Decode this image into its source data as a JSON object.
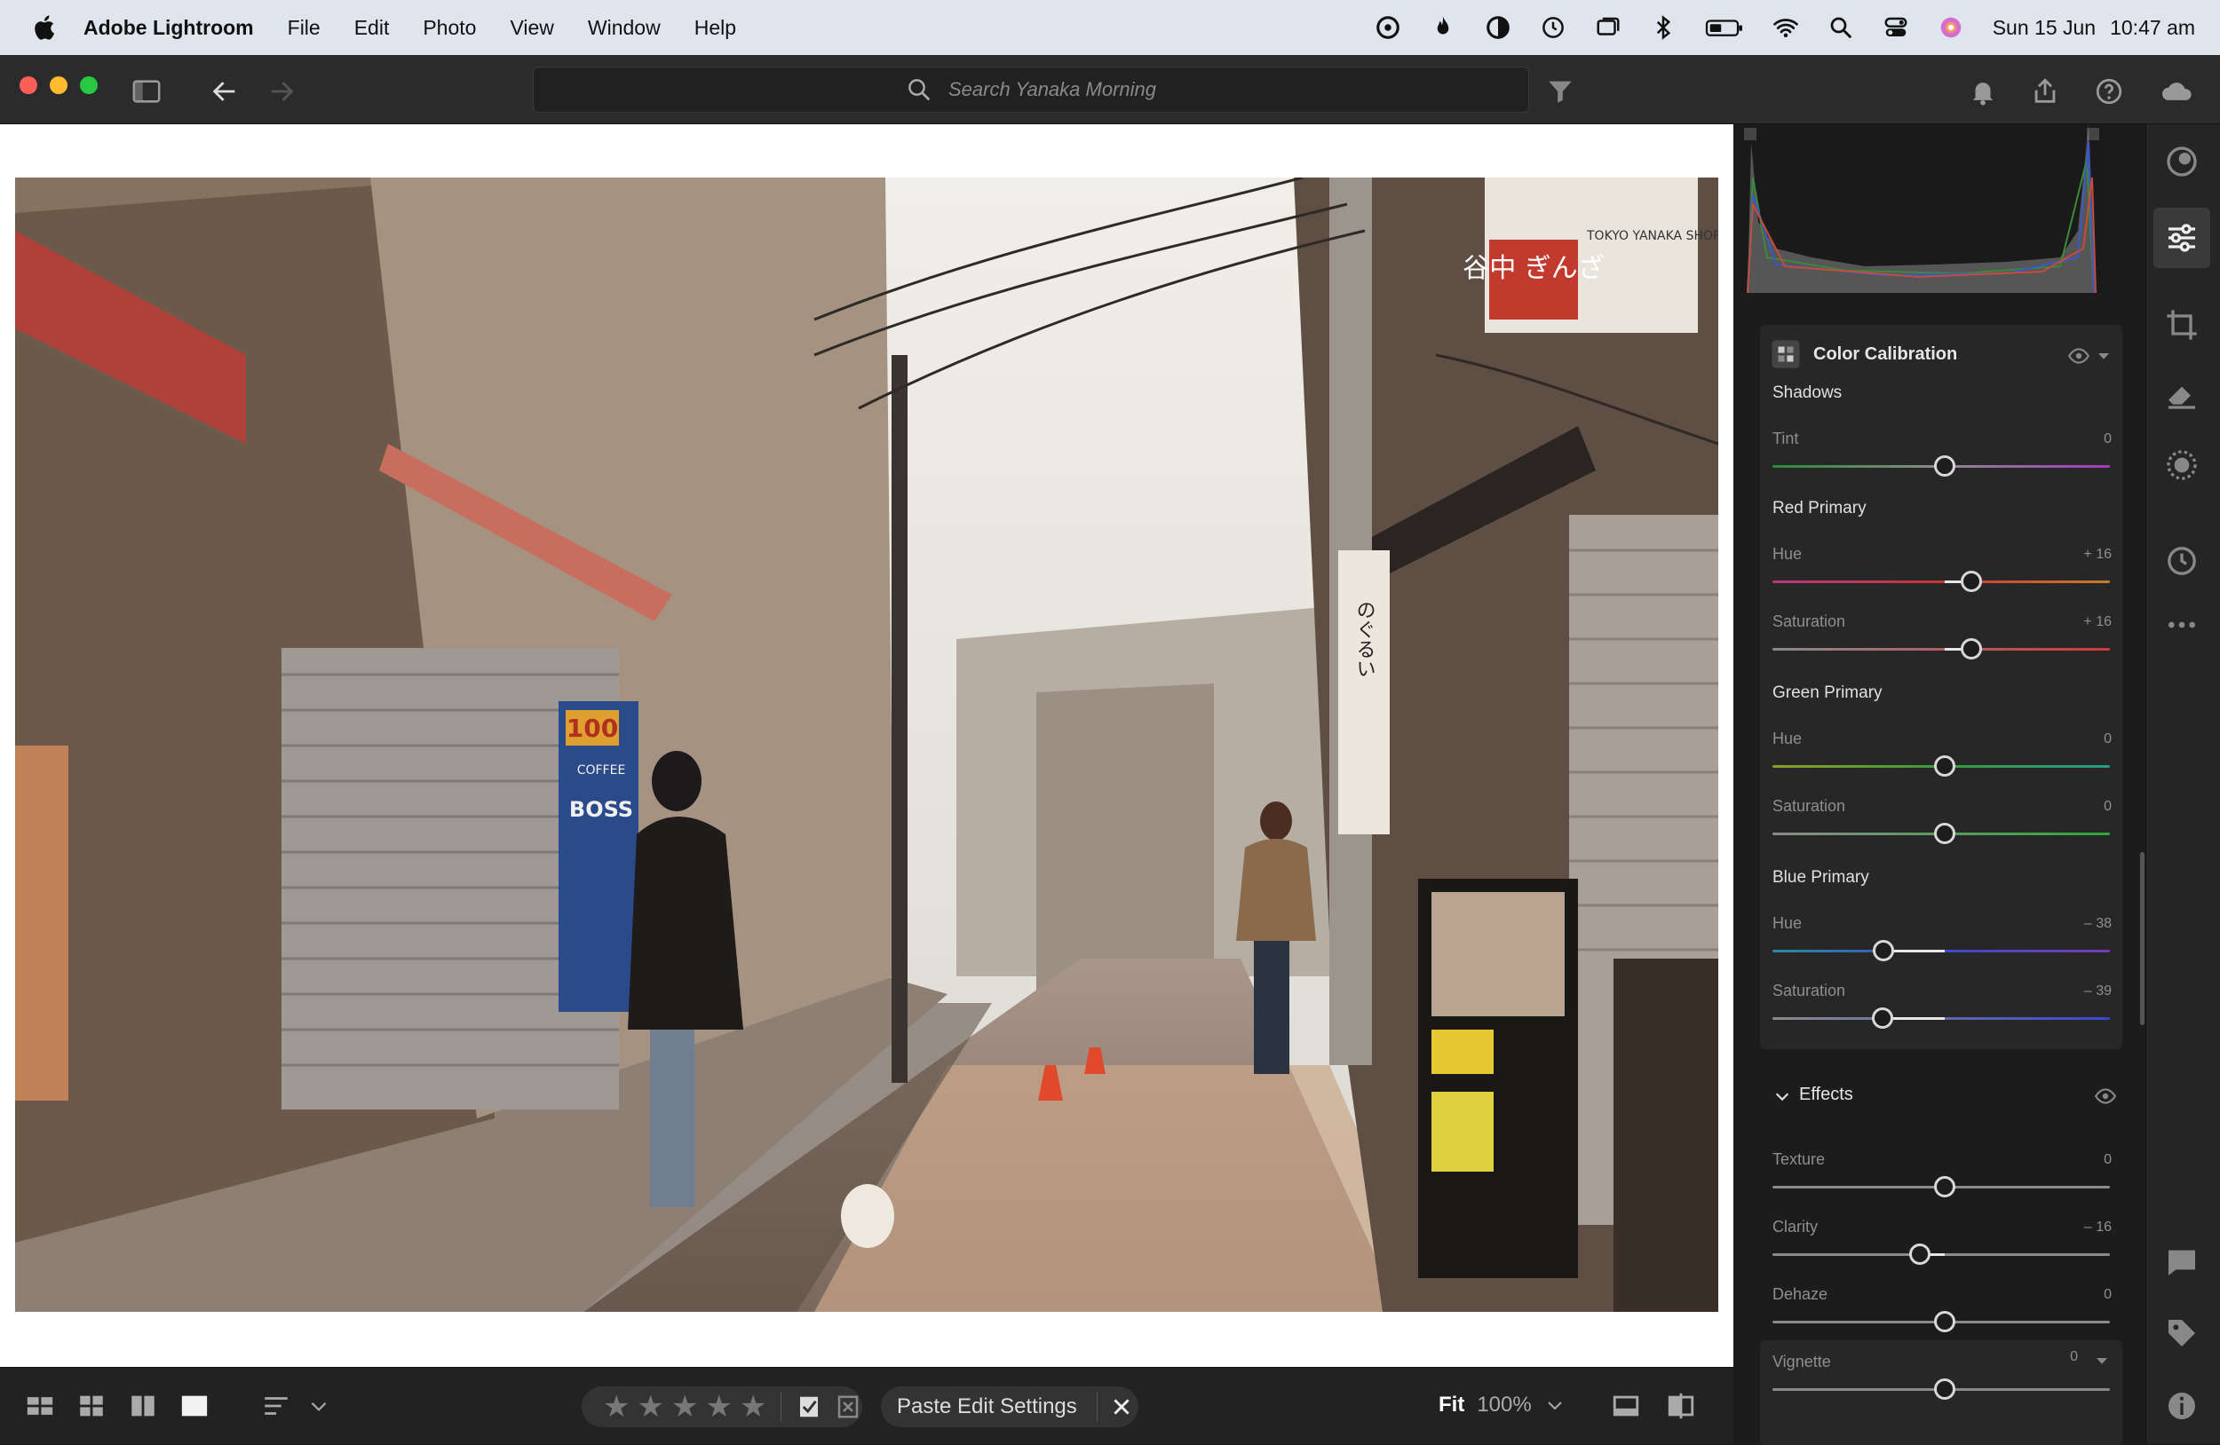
{
  "menubar": {
    "app_name": "Adobe Lightroom",
    "items": [
      "File",
      "Edit",
      "Photo",
      "View",
      "Window",
      "Help"
    ],
    "date": "Sun 15 Jun",
    "time": "10:47 am"
  },
  "titlebar": {
    "search_placeholder": "Search Yanaka Morning"
  },
  "photo": {
    "signs": [
      "谷中 ぎんざ",
      "TOKYO YANAKA SHOPPING STREET",
      "100",
      "COFFEE",
      "BOSS",
      "のぐるい"
    ]
  },
  "bottombar": {
    "paste_label": "Paste Edit Settings",
    "fit_label": "Fit",
    "zoom_label": "100%"
  },
  "color_calibration": {
    "title": "Color Calibration",
    "groups": [
      {
        "name": "Shadows",
        "sliders": [
          {
            "label": "Tint",
            "value": "0"
          }
        ]
      },
      {
        "name": "Red Primary",
        "sliders": [
          {
            "label": "Hue",
            "value": "+ 16"
          },
          {
            "label": "Saturation",
            "value": "+ 16"
          }
        ]
      },
      {
        "name": "Green Primary",
        "sliders": [
          {
            "label": "Hue",
            "value": "0"
          },
          {
            "label": "Saturation",
            "value": "0"
          }
        ]
      },
      {
        "name": "Blue Primary",
        "sliders": [
          {
            "label": "Hue",
            "value": "– 38"
          },
          {
            "label": "Saturation",
            "value": "– 39"
          }
        ]
      }
    ]
  },
  "effects": {
    "title": "Effects",
    "sliders": [
      {
        "label": "Texture",
        "value": "0"
      },
      {
        "label": "Clarity",
        "value": "– 16"
      },
      {
        "label": "Dehaze",
        "value": "0"
      },
      {
        "label": "Vignette",
        "value": "0"
      }
    ]
  }
}
